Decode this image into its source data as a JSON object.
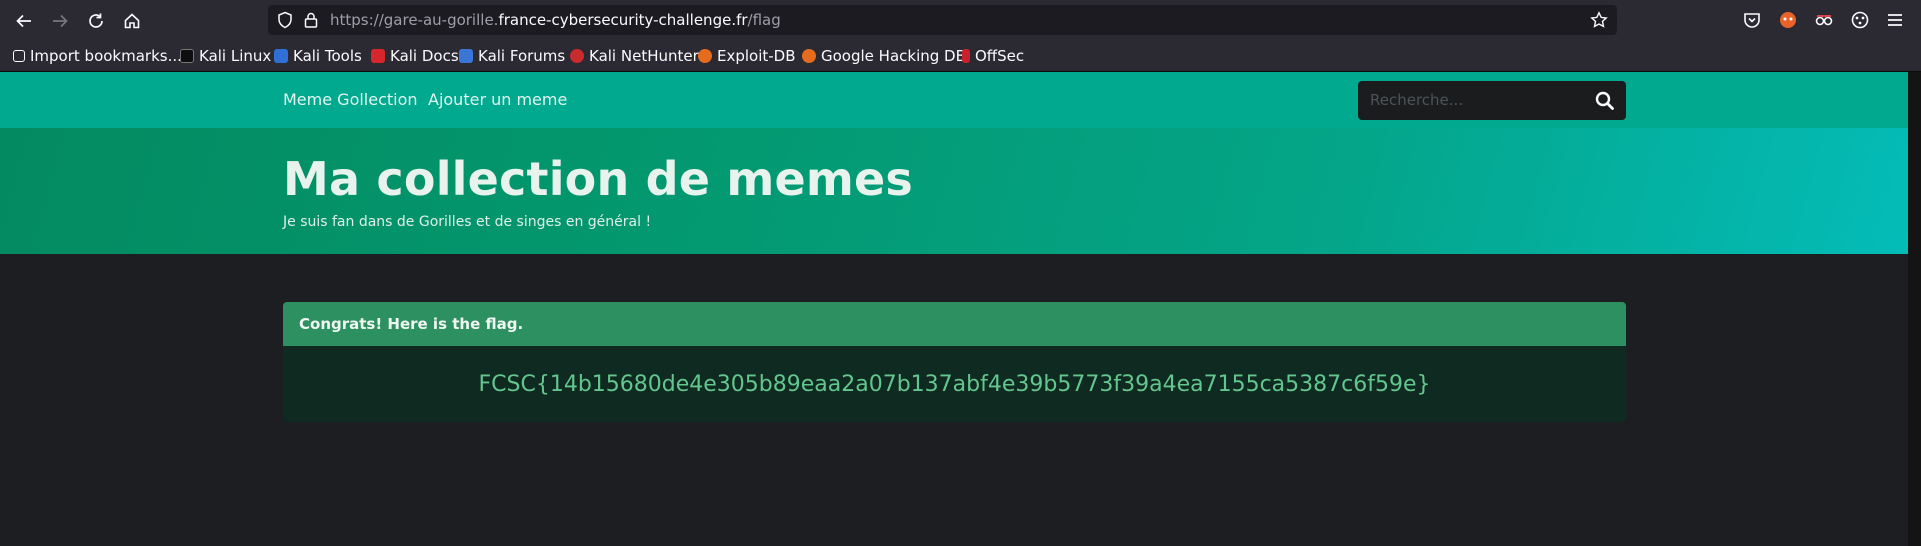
{
  "browser": {
    "url_prefix": "https://gare-au-gorille.",
    "url_host": "france-cybersecurity-challenge.fr",
    "url_path": "/flag"
  },
  "bookmarks": [
    {
      "label": "Import bookmarks...",
      "icon": "import-icon"
    },
    {
      "label": "Kali Linux",
      "icon": "kali-dragon-icon"
    },
    {
      "label": "Kali Tools",
      "icon": "kali-tools-icon"
    },
    {
      "label": "Kali Docs",
      "icon": "kali-docs-icon"
    },
    {
      "label": "Kali Forums",
      "icon": "kali-forums-icon"
    },
    {
      "label": "Kali NetHunter",
      "icon": "nethunter-icon"
    },
    {
      "label": "Exploit-DB",
      "icon": "exploit-db-icon"
    },
    {
      "label": "Google Hacking DB",
      "icon": "ghdb-icon"
    },
    {
      "label": "OffSec",
      "icon": "offsec-icon"
    }
  ],
  "site": {
    "nav": {
      "brand": "Meme Gollection",
      "add_link": "Ajouter un meme",
      "search_placeholder": "Recherche..."
    },
    "hero": {
      "title": "Ma collection de memes",
      "subtitle": "Je suis fan dans de Gorilles et de singes en général !"
    },
    "card": {
      "header": "Congrats! Here is the flag.",
      "flag": "FCSC{14b15680de4e305b89eaa2a07b137abf4e39b5773f39a4ea7155ca5387c6f59e}"
    }
  },
  "colors": {
    "navbar": "#01a98f",
    "card_header": "#2d9060",
    "flag_text": "#63c68e"
  }
}
